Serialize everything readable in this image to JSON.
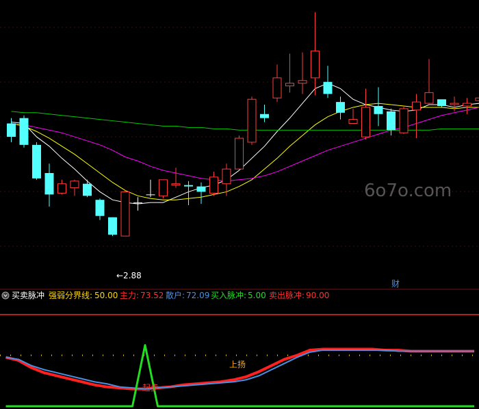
{
  "watermark": "6o7o.com",
  "main_panel": {
    "low_annotation": "←2.88",
    "marker_text": "财"
  },
  "indicator": {
    "name": "买卖脉冲",
    "fields": [
      {
        "label": "强弱分界线:",
        "value": "50.00",
        "color": "#ffd700"
      },
      {
        "label": "主力:",
        "value": "73.52",
        "color": "#ff3030"
      },
      {
        "label": "散户:",
        "value": "72.09",
        "color": "#4a90e2"
      },
      {
        "label": "买入脉冲:",
        "value": "5.00",
        "color": "#22dd22"
      },
      {
        "label": "卖出脉冲:",
        "value": "90.00",
        "color": "#ff3030"
      }
    ],
    "annotations": [
      {
        "text": "上扬",
        "color": "#ffa500"
      },
      {
        "text": "起步",
        "color": "#ff3030"
      }
    ]
  },
  "colors": {
    "background": "#000000",
    "up_candle": "#ff3b3b",
    "down_candle": "#54ffff",
    "doji": "#ffffff",
    "ma_white": "#ffffff",
    "ma_yellow": "#ffff00",
    "ma_magenta": "#ff00ff",
    "ma_green": "#00cc00",
    "main_force": "#ff2020",
    "retail": "#4a90e2",
    "pulse": "#22dd22",
    "sell_line": "#ff2020",
    "neutral_line": "#ffd700"
  },
  "chart_data": [
    {
      "type": "candlestick",
      "title": "",
      "low_label_value": 2.88,
      "ylim": [
        2.6,
        4.6
      ],
      "candles": [
        {
          "o": 3.72,
          "h": 3.76,
          "l": 3.58,
          "c": 3.62
        },
        {
          "o": 3.76,
          "h": 3.78,
          "l": 3.54,
          "c": 3.56
        },
        {
          "o": 3.56,
          "h": 3.58,
          "l": 3.3,
          "c": 3.31
        },
        {
          "o": 3.35,
          "h": 3.42,
          "l": 3.1,
          "c": 3.19
        },
        {
          "o": 3.2,
          "h": 3.3,
          "l": 3.19,
          "c": 3.27
        },
        {
          "o": 3.24,
          "h": 3.3,
          "l": 3.18,
          "c": 3.29
        },
        {
          "o": 3.27,
          "h": 3.3,
          "l": 3.17,
          "c": 3.18
        },
        {
          "o": 3.15,
          "h": 3.16,
          "l": 3.0,
          "c": 3.03
        },
        {
          "o": 3.02,
          "h": 3.02,
          "l": 2.88,
          "c": 2.89
        },
        {
          "o": 2.88,
          "h": 3.22,
          "l": 2.88,
          "c": 3.21
        },
        {
          "o": 3.13,
          "h": 3.17,
          "l": 3.07,
          "c": 3.13
        },
        {
          "o": 3.19,
          "h": 3.3,
          "l": 3.17,
          "c": 3.19
        },
        {
          "o": 3.18,
          "h": 3.29,
          "l": 3.16,
          "c": 3.3
        },
        {
          "o": 3.26,
          "h": 3.39,
          "l": 3.24,
          "c": 3.27
        },
        {
          "o": 3.26,
          "h": 3.29,
          "l": 3.11,
          "c": 3.25
        },
        {
          "o": 3.25,
          "h": 3.28,
          "l": 3.12,
          "c": 3.21
        },
        {
          "o": 3.2,
          "h": 3.36,
          "l": 3.18,
          "c": 3.32
        },
        {
          "o": 3.27,
          "h": 3.42,
          "l": 3.18,
          "c": 3.38
        },
        {
          "o": 3.38,
          "h": 3.63,
          "l": 3.37,
          "c": 3.61
        },
        {
          "o": 3.58,
          "h": 3.92,
          "l": 3.56,
          "c": 3.9
        },
        {
          "o": 3.79,
          "h": 3.86,
          "l": 3.73,
          "c": 3.76
        },
        {
          "o": 3.91,
          "h": 4.16,
          "l": 3.88,
          "c": 4.06
        },
        {
          "o": 4.0,
          "h": 4.24,
          "l": 3.95,
          "c": 4.02
        },
        {
          "o": 4.02,
          "h": 4.25,
          "l": 3.94,
          "c": 4.04
        },
        {
          "o": 4.06,
          "h": 4.55,
          "l": 3.93,
          "c": 4.26
        },
        {
          "o": 4.03,
          "h": 4.15,
          "l": 3.91,
          "c": 3.94
        },
        {
          "o": 3.88,
          "h": 3.92,
          "l": 3.75,
          "c": 3.8
        },
        {
          "o": 3.72,
          "h": 3.83,
          "l": 3.73,
          "c": 3.75
        },
        {
          "o": 3.62,
          "h": 3.98,
          "l": 3.6,
          "c": 3.84
        },
        {
          "o": 3.85,
          "h": 3.99,
          "l": 3.7,
          "c": 3.79
        },
        {
          "o": 3.81,
          "h": 3.83,
          "l": 3.63,
          "c": 3.67
        },
        {
          "o": 3.65,
          "h": 3.85,
          "l": 3.64,
          "c": 3.83
        },
        {
          "o": 3.82,
          "h": 3.94,
          "l": 3.61,
          "c": 3.88
        },
        {
          "o": 3.87,
          "h": 4.2,
          "l": 3.86,
          "c": 3.95
        },
        {
          "o": 3.9,
          "h": 3.88,
          "l": 3.84,
          "c": 3.85
        },
        {
          "o": 3.86,
          "h": 3.92,
          "l": 3.81,
          "c": 3.87
        },
        {
          "o": 3.85,
          "h": 3.91,
          "l": 3.79,
          "c": 3.87
        },
        {
          "o": 3.89,
          "h": 3.94,
          "l": 3.84,
          "c": 3.91
        }
      ],
      "ma_lines": [
        {
          "color": "#ffffff",
          "values": [
            3.73,
            3.72,
            3.62,
            3.55,
            3.46,
            3.38,
            3.29,
            3.21,
            3.15,
            3.13,
            3.12,
            3.13,
            3.13,
            3.17,
            3.21,
            3.24,
            3.26,
            3.3,
            3.37,
            3.46,
            3.55,
            3.66,
            3.76,
            3.87,
            3.98,
            4.02,
            3.98,
            3.9,
            3.86,
            3.84,
            3.82,
            3.81,
            3.82,
            3.86,
            3.86,
            3.84,
            3.86,
            3.87
          ]
        },
        {
          "color": "#ffff00",
          "values": [
            3.72,
            3.7,
            3.66,
            3.61,
            3.55,
            3.49,
            3.42,
            3.35,
            3.28,
            3.22,
            3.18,
            3.16,
            3.15,
            3.15,
            3.16,
            3.17,
            3.19,
            3.21,
            3.25,
            3.3,
            3.38,
            3.46,
            3.55,
            3.63,
            3.71,
            3.77,
            3.81,
            3.84,
            3.86,
            3.87,
            3.86,
            3.85,
            3.84,
            3.84,
            3.84,
            3.83,
            3.84,
            3.84
          ]
        },
        {
          "color": "#ff00ff",
          "values": [
            3.72,
            3.71,
            3.69,
            3.67,
            3.65,
            3.62,
            3.59,
            3.56,
            3.52,
            3.47,
            3.44,
            3.4,
            3.37,
            3.35,
            3.33,
            3.31,
            3.3,
            3.29,
            3.3,
            3.31,
            3.33,
            3.36,
            3.4,
            3.44,
            3.48,
            3.52,
            3.55,
            3.58,
            3.61,
            3.64,
            3.67,
            3.69,
            3.72,
            3.75,
            3.78,
            3.8,
            3.82,
            3.84
          ]
        },
        {
          "color": "#00cc00",
          "values": [
            3.81,
            3.8,
            3.8,
            3.79,
            3.78,
            3.77,
            3.76,
            3.75,
            3.74,
            3.73,
            3.72,
            3.71,
            3.7,
            3.7,
            3.69,
            3.69,
            3.68,
            3.68,
            3.67,
            3.67,
            3.67,
            3.67,
            3.67,
            3.67,
            3.67,
            3.67,
            3.67,
            3.67,
            3.67,
            3.67,
            3.67,
            3.67,
            3.67,
            3.67,
            3.68,
            3.68,
            3.68,
            3.68
          ]
        }
      ]
    },
    {
      "type": "line",
      "title": "买卖脉冲",
      "ylim": [
        0,
        100
      ],
      "reference_lines": [
        {
          "name": "强弱分界线",
          "value": 50,
          "color": "#ffd700",
          "style": "dotted"
        },
        {
          "name": "卖出脉冲",
          "value": 90,
          "color": "#ff2020"
        }
      ],
      "series": [
        {
          "name": "主力",
          "color": "#ff2020",
          "values": [
            48,
            45,
            38,
            33,
            30,
            27,
            24,
            21,
            19,
            18,
            17,
            17,
            18,
            19,
            21,
            22,
            23,
            24,
            26,
            29,
            34,
            40,
            46,
            50,
            55,
            56,
            56,
            56,
            56,
            56,
            55,
            55,
            54,
            54,
            54,
            54,
            54,
            54
          ]
        },
        {
          "name": "散户",
          "color": "#4a90e2",
          "values": [
            48,
            46,
            40,
            36,
            33,
            30,
            27,
            24,
            22,
            19,
            18,
            17,
            18,
            19,
            20,
            21,
            22,
            23,
            24,
            26,
            30,
            36,
            42,
            48,
            53,
            55,
            55,
            55,
            55,
            55,
            55,
            54,
            54,
            54,
            54,
            54,
            54,
            54
          ]
        },
        {
          "name": "买入脉冲",
          "color": "#22dd22",
          "values": [
            0,
            0,
            0,
            0,
            0,
            0,
            0,
            0,
            0,
            0,
            0,
            60,
            0,
            0,
            0,
            0,
            0,
            0,
            0,
            0,
            0,
            0,
            0,
            0,
            0,
            0,
            0,
            0,
            0,
            0,
            0,
            0,
            0,
            0,
            0,
            0,
            0,
            0
          ]
        }
      ]
    }
  ]
}
